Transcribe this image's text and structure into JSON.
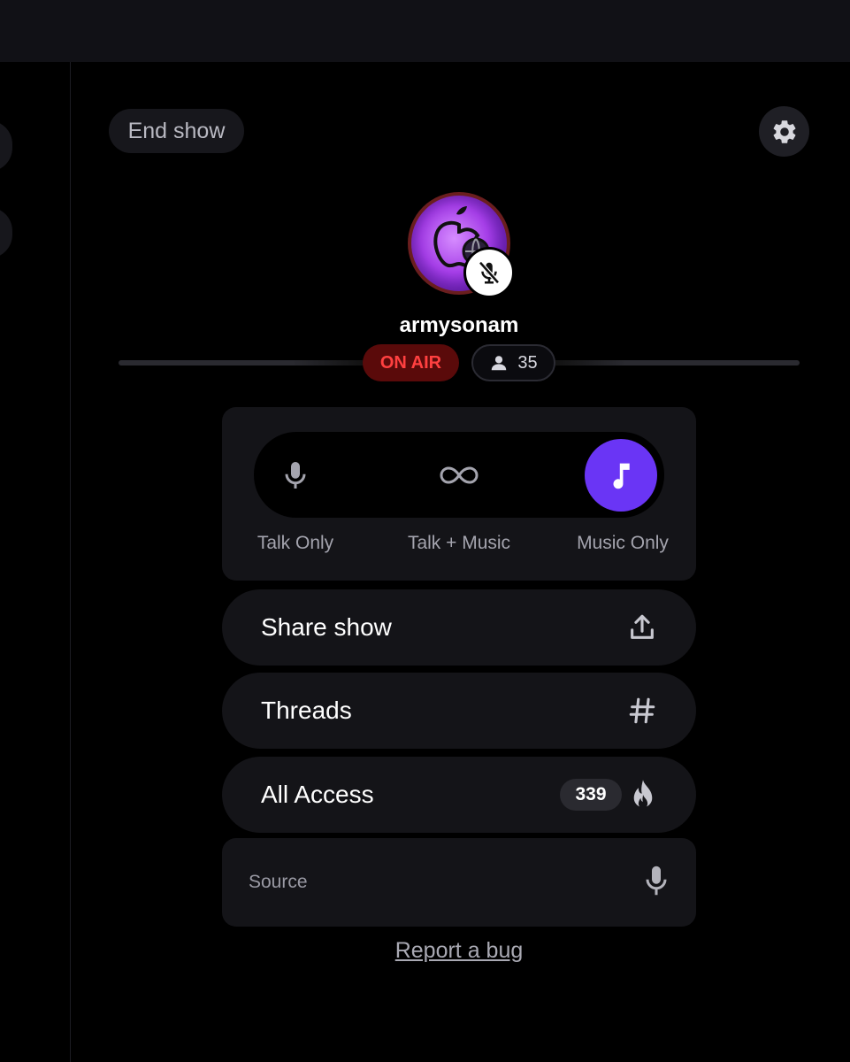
{
  "header": {
    "end_show_label": "End show",
    "settings_icon": "gear-icon"
  },
  "host": {
    "username": "armysonam",
    "avatar_icon": "apple-globe-logo",
    "mic_status_icon": "mic-off-icon"
  },
  "status": {
    "on_air_label": "ON AIR",
    "listener_count": "35",
    "listener_icon": "person-icon",
    "on_air_color": "#ff4040"
  },
  "modes": {
    "selected": "Music Only",
    "accent": "#6a35f5",
    "items": [
      {
        "label": "Talk Only",
        "icon": "mic-icon"
      },
      {
        "label": "Talk + Music",
        "icon": "infinity-icon"
      },
      {
        "label": "Music Only",
        "icon": "music-note-icon"
      }
    ]
  },
  "actions": {
    "share": {
      "label": "Share show",
      "icon": "upload-icon"
    },
    "threads": {
      "label": "Threads",
      "icon": "hashtag-icon"
    },
    "all_access": {
      "label": "All Access",
      "count": "339",
      "icon": "flame-icon"
    }
  },
  "source": {
    "placeholder": "Source",
    "value": "",
    "icon": "mic-icon"
  },
  "footer": {
    "report_label": "Report a bug"
  }
}
